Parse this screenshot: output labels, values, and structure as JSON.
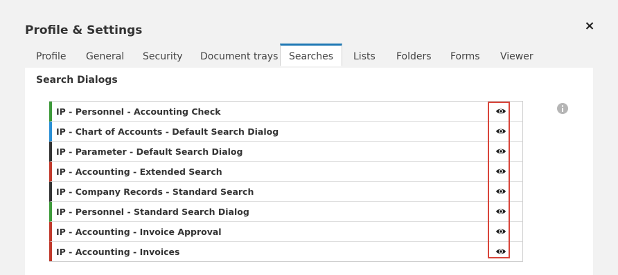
{
  "dialog": {
    "title": "Profile & Settings",
    "close_glyph": "×"
  },
  "tabs": [
    {
      "label": "Profile",
      "active": false
    },
    {
      "label": "General",
      "active": false
    },
    {
      "label": "Security",
      "active": false
    },
    {
      "label": "Document trays",
      "active": false
    },
    {
      "label": "Searches",
      "active": true
    },
    {
      "label": "Lists",
      "active": false
    },
    {
      "label": "Folders",
      "active": false
    },
    {
      "label": "Forms",
      "active": false
    },
    {
      "label": "Viewer",
      "active": false
    }
  ],
  "section": {
    "title": "Search Dialogs"
  },
  "colors": {
    "green": "#3d9a3a",
    "blue": "#2a8fd4",
    "dark": "#333333",
    "red": "#c0392b",
    "highlight": "#d9453a",
    "tab_accent": "#1e78b4",
    "info": "#b5b5b5"
  },
  "search_dialogs": [
    {
      "label": "IP - Personnel - Accounting Check",
      "color": "green",
      "icon": "eye-icon"
    },
    {
      "label": "IP - Chart of Accounts - Default Search Dialog",
      "color": "blue",
      "icon": "eye-icon"
    },
    {
      "label": "IP - Parameter - Default Search Dialog",
      "color": "dark",
      "icon": "eye-icon"
    },
    {
      "label": "IP - Accounting - Extended Search",
      "color": "red",
      "icon": "eye-icon"
    },
    {
      "label": "IP - Company Records - Standard Search",
      "color": "dark",
      "icon": "eye-icon"
    },
    {
      "label": "IP - Personnel - Standard Search Dialog",
      "color": "green",
      "icon": "eye-icon"
    },
    {
      "label": "IP - Accounting - Invoice Approval",
      "color": "red",
      "icon": "eye-icon"
    },
    {
      "label": "IP - Accounting - Invoices",
      "color": "red",
      "icon": "eye-icon"
    }
  ]
}
